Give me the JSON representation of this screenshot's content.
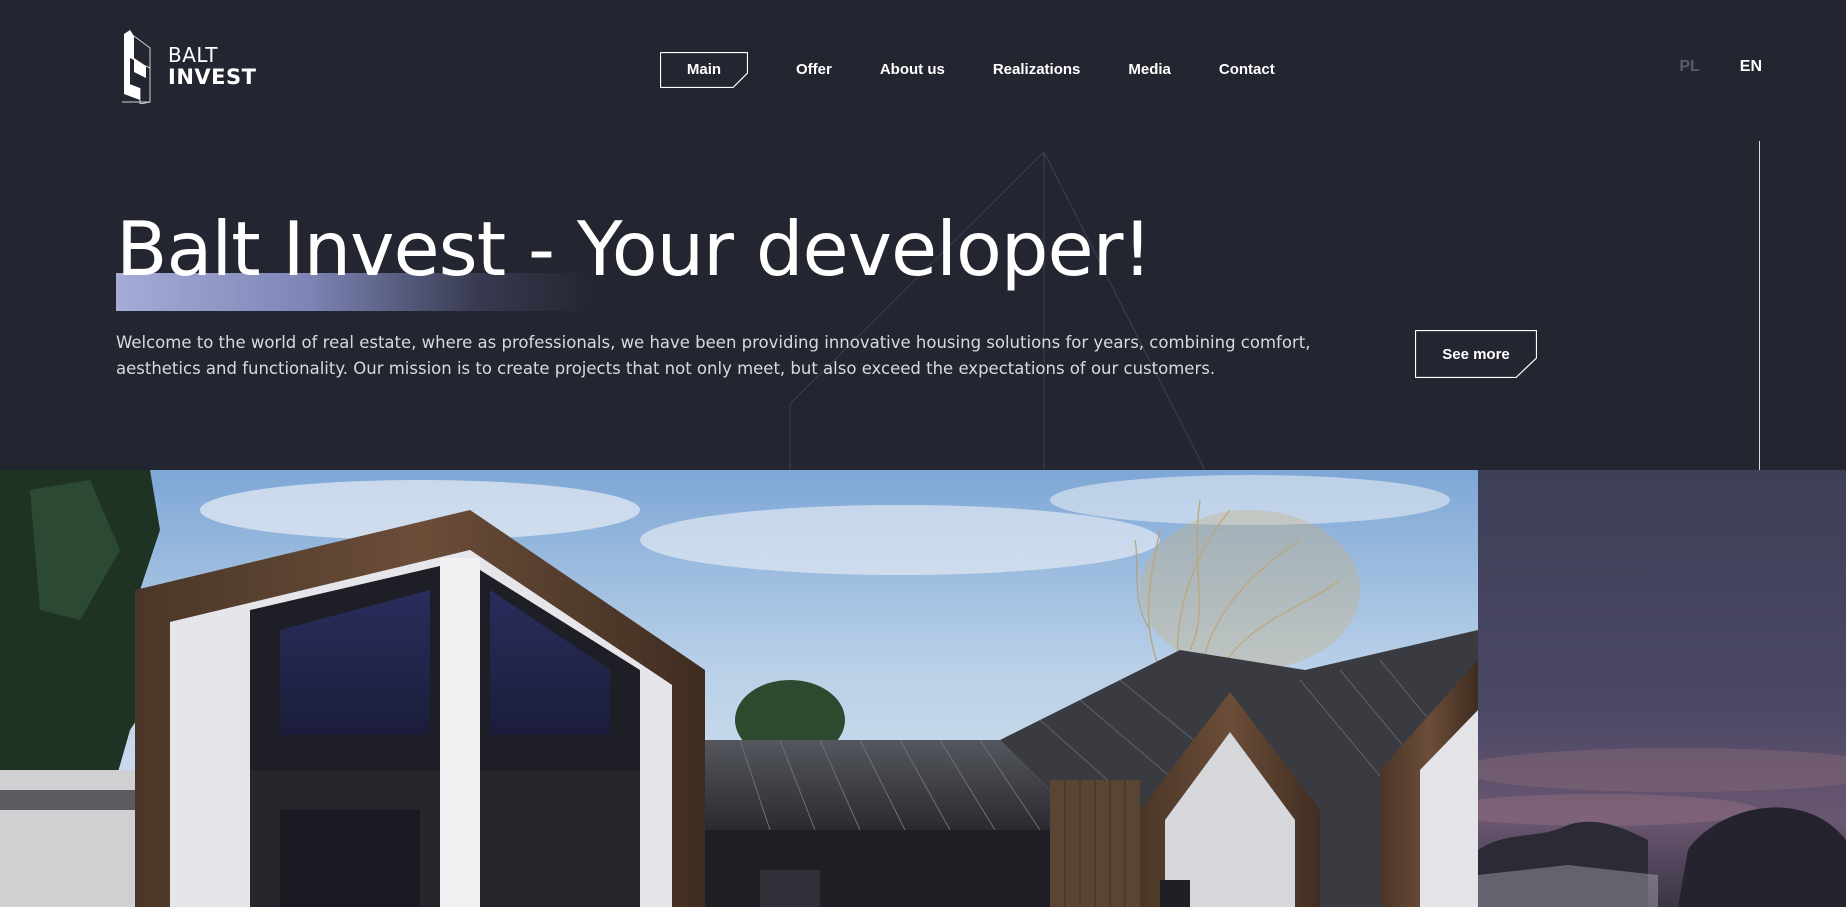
{
  "logo": {
    "line1": "BALT",
    "line2": "INVEST"
  },
  "nav": {
    "items": [
      {
        "label": "Main",
        "active": true
      },
      {
        "label": "Offer"
      },
      {
        "label": "About us"
      },
      {
        "label": "Realizations"
      },
      {
        "label": "Media"
      },
      {
        "label": "Contact"
      }
    ]
  },
  "language": {
    "options": [
      "PL",
      "EN"
    ],
    "selected": "EN"
  },
  "hero": {
    "title": "Balt Invest - Your developer!",
    "description": "Welcome to the world of real estate, where as professionals, we have been providing innovative housing solutions for years, combining comfort, aesthetics and functionality. Our mission is to create projects that not only meet, but also exceed the expectations of our customers.",
    "cta_label": "See more"
  },
  "colors": {
    "background": "#232530",
    "accent_gradient_start": "#a6acd8",
    "text_muted": "#d8d9e0",
    "inactive_lang": "#5a5c68"
  },
  "icons": {
    "scroll": "arrow-down-icon",
    "logo": "building-logo-icon"
  }
}
